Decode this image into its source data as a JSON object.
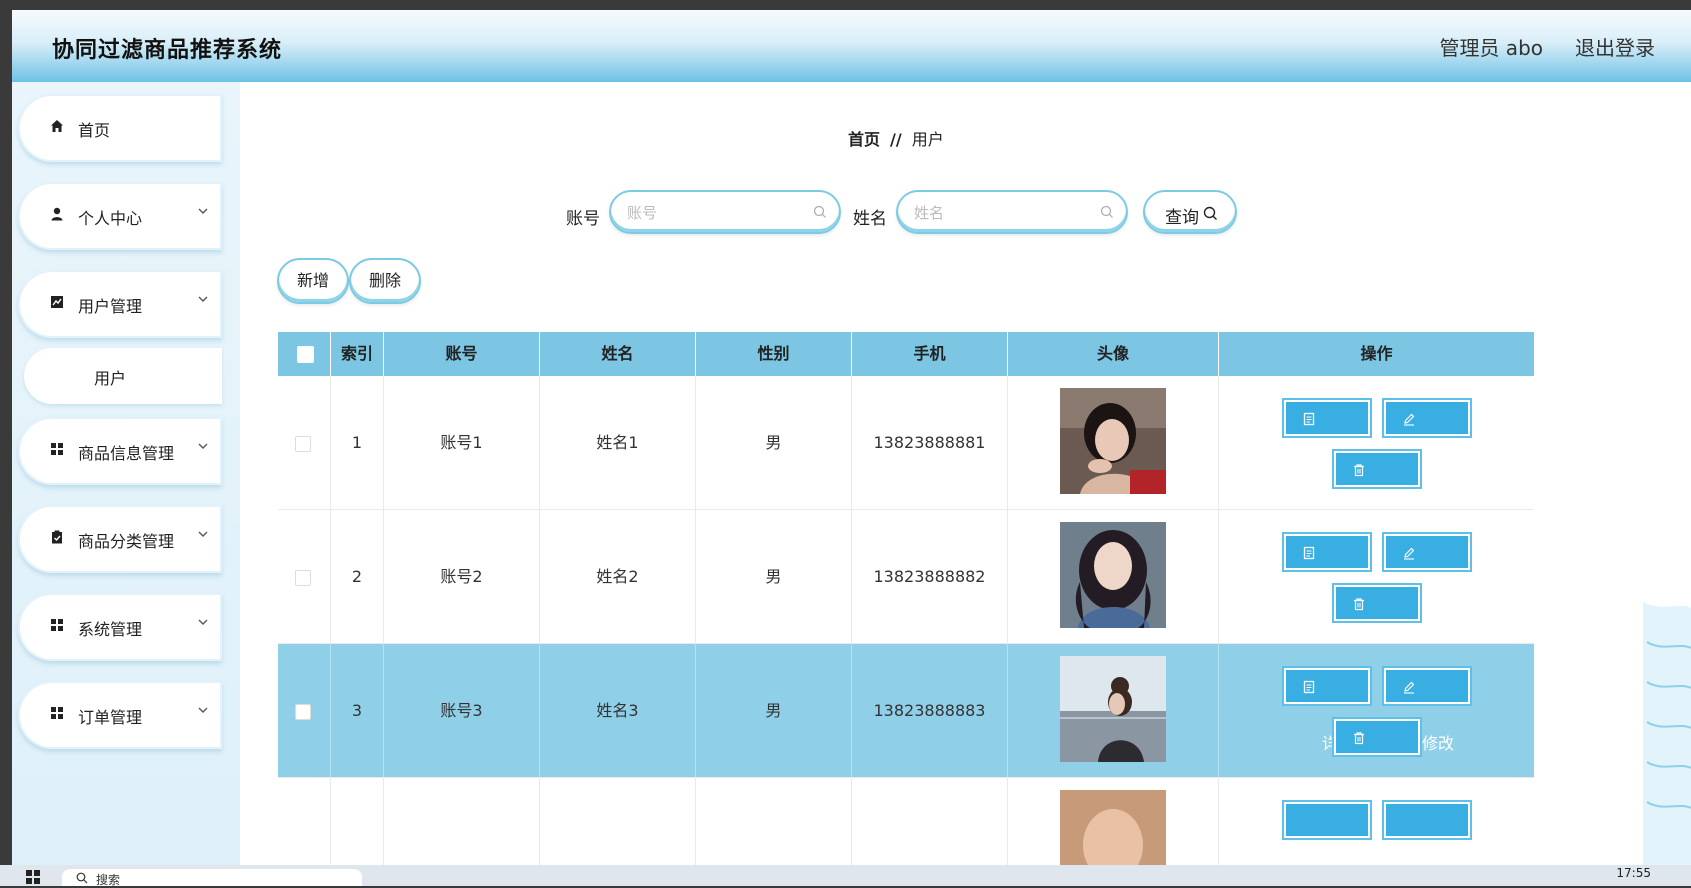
{
  "header": {
    "title": "协同过滤商品推荐系统",
    "admin_label": "管理员 abo",
    "logout_label": "退出登录"
  },
  "sidebar": {
    "items": [
      {
        "label": "首页",
        "icon": "home-icon",
        "has_children": false
      },
      {
        "label": "个人中心",
        "icon": "user-icon",
        "has_children": true
      },
      {
        "label": "用户管理",
        "icon": "chart-icon",
        "has_children": true
      },
      {
        "label": "商品信息管理",
        "icon": "grid-icon",
        "has_children": true
      },
      {
        "label": "商品分类管理",
        "icon": "clipboard-icon",
        "has_children": true
      },
      {
        "label": "系统管理",
        "icon": "grid-icon",
        "has_children": true
      },
      {
        "label": "订单管理",
        "icon": "grid-icon",
        "has_children": true
      }
    ],
    "submenu": {
      "label": "用户"
    }
  },
  "breadcrumb": {
    "home": "首页",
    "separator": "//",
    "current": "用户"
  },
  "search": {
    "account_label": "账号",
    "account_placeholder": "账号",
    "name_label": "姓名",
    "name_placeholder": "姓名",
    "query_label": "查询"
  },
  "actions": {
    "add_label": "新增",
    "delete_label": "删除"
  },
  "table": {
    "columns": [
      "索引",
      "账号",
      "姓名",
      "性别",
      "手机",
      "头像",
      "操作"
    ],
    "rows": [
      {
        "index": "1",
        "account": "账号1",
        "name": "姓名1",
        "gender": "男",
        "phone": "13823888881",
        "highlighted": false
      },
      {
        "index": "2",
        "account": "账号2",
        "name": "姓名2",
        "gender": "男",
        "phone": "13823888882",
        "highlighted": false
      },
      {
        "index": "3",
        "account": "账号3",
        "name": "姓名3",
        "gender": "男",
        "phone": "13823888883",
        "highlighted": true
      }
    ],
    "row_buttons": {
      "detail_label": "详情",
      "edit_label": "修改",
      "delete_label": "删除"
    }
  },
  "taskbar": {
    "search_label": "搜索",
    "time": "17:55"
  },
  "colors": {
    "accent": "#38aee2",
    "header_row": "#7cc6e3",
    "highlight_row": "#8fd0e8"
  }
}
